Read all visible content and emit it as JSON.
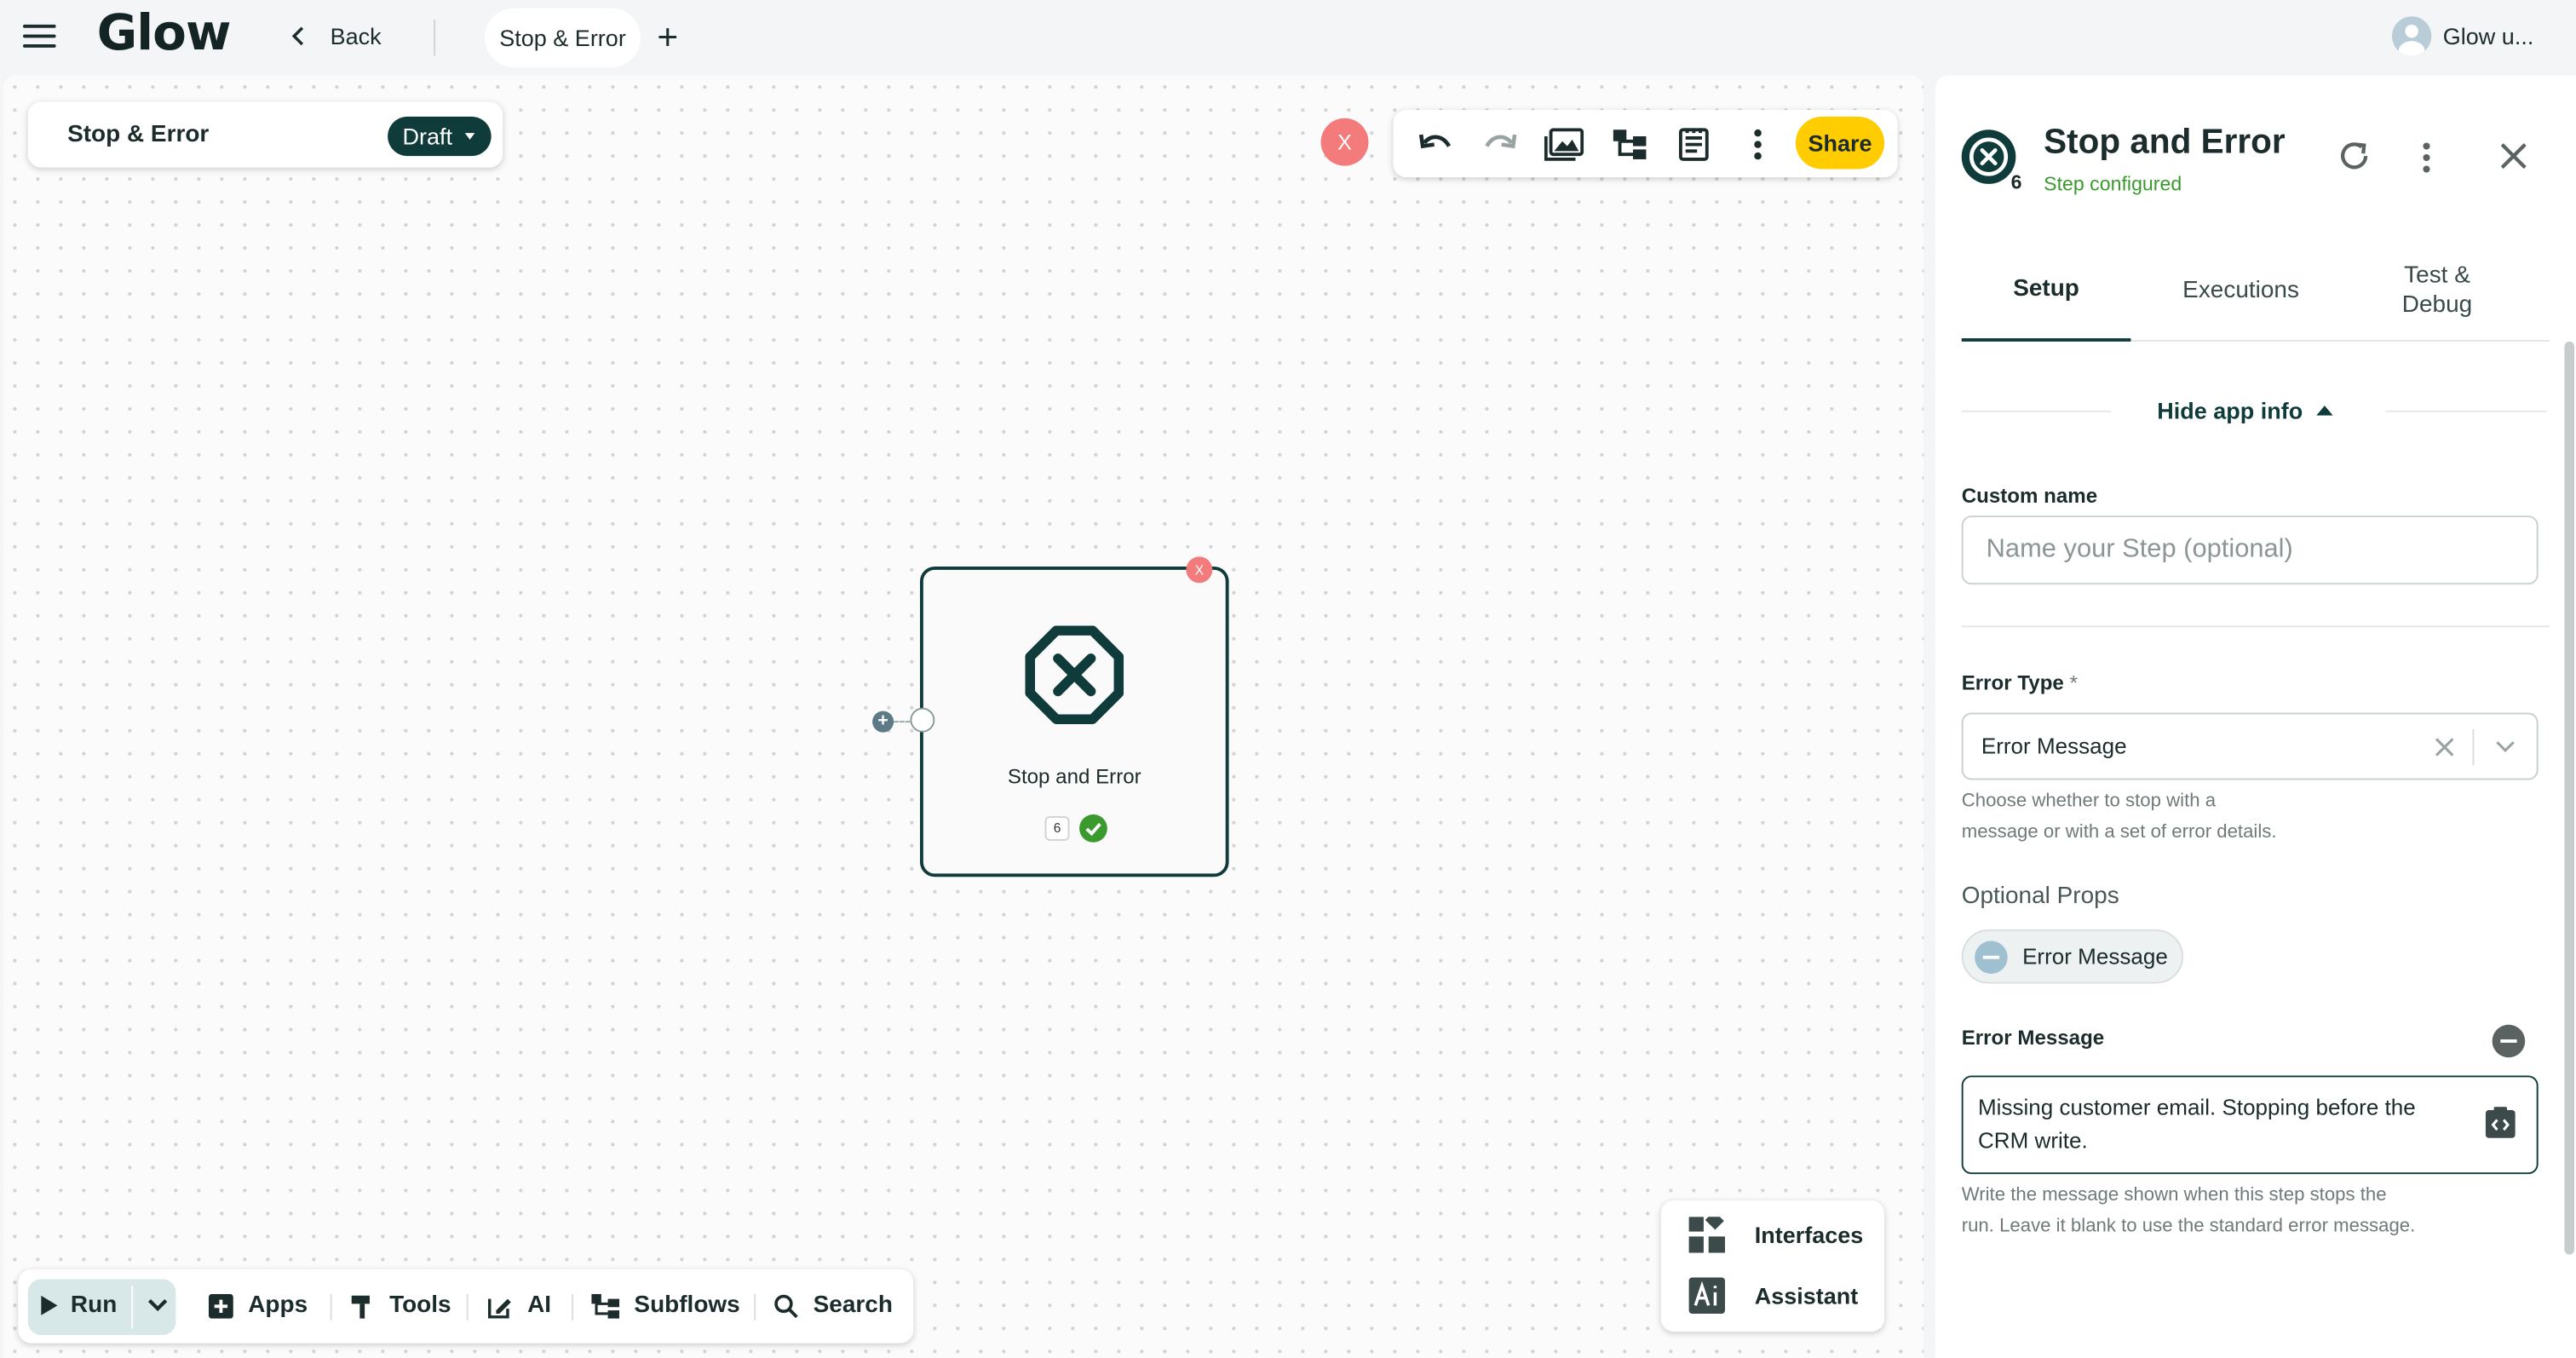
{
  "app": {
    "logo": "Glow",
    "back_label": "Back",
    "tab_label": "Stop & Error",
    "user_name": "Glow u..."
  },
  "canvas": {
    "flow_name": "Stop & Error",
    "status_label": "Draft",
    "error_badge": "X",
    "share_label": "Share",
    "node": {
      "title": "Stop and Error",
      "step_number": "6",
      "error_badge": "X"
    },
    "bottom": {
      "run": "Run",
      "apps": "Apps",
      "tools": "Tools",
      "ai": "AI",
      "subflows": "Subflows",
      "search": "Search"
    },
    "side": {
      "interfaces": "Interfaces",
      "assistant": "Assistant"
    }
  },
  "panel": {
    "title": "Stop and Error",
    "step_number": "6",
    "subtitle": "Step configured",
    "tabs": [
      {
        "label": "Setup"
      },
      {
        "label": "Executions"
      },
      {
        "label": "Test &\nDebug"
      }
    ],
    "hide_info": "Hide app info",
    "custom_name_label": "Custom name",
    "custom_name_placeholder": "Name your Step (optional)",
    "error_type_label": "Error Type",
    "required_mark": "*",
    "error_type_value": "Error Message",
    "error_type_hint": "Choose whether to stop with a\nmessage or with a set of error details.",
    "optional_props_label": "Optional Props",
    "optional_chip": "Error Message",
    "error_message_label": "Error Message",
    "error_message_value": "Missing customer email. Stopping before the CRM write.",
    "error_message_hint": "Write the message shown when this step stops the\nrun. Leave it blank to use the standard error message."
  },
  "colors": {
    "brand": "#0f3b3b",
    "accent": "#ffcc00",
    "success": "#3a9a2e",
    "danger": "#f47b7b"
  }
}
